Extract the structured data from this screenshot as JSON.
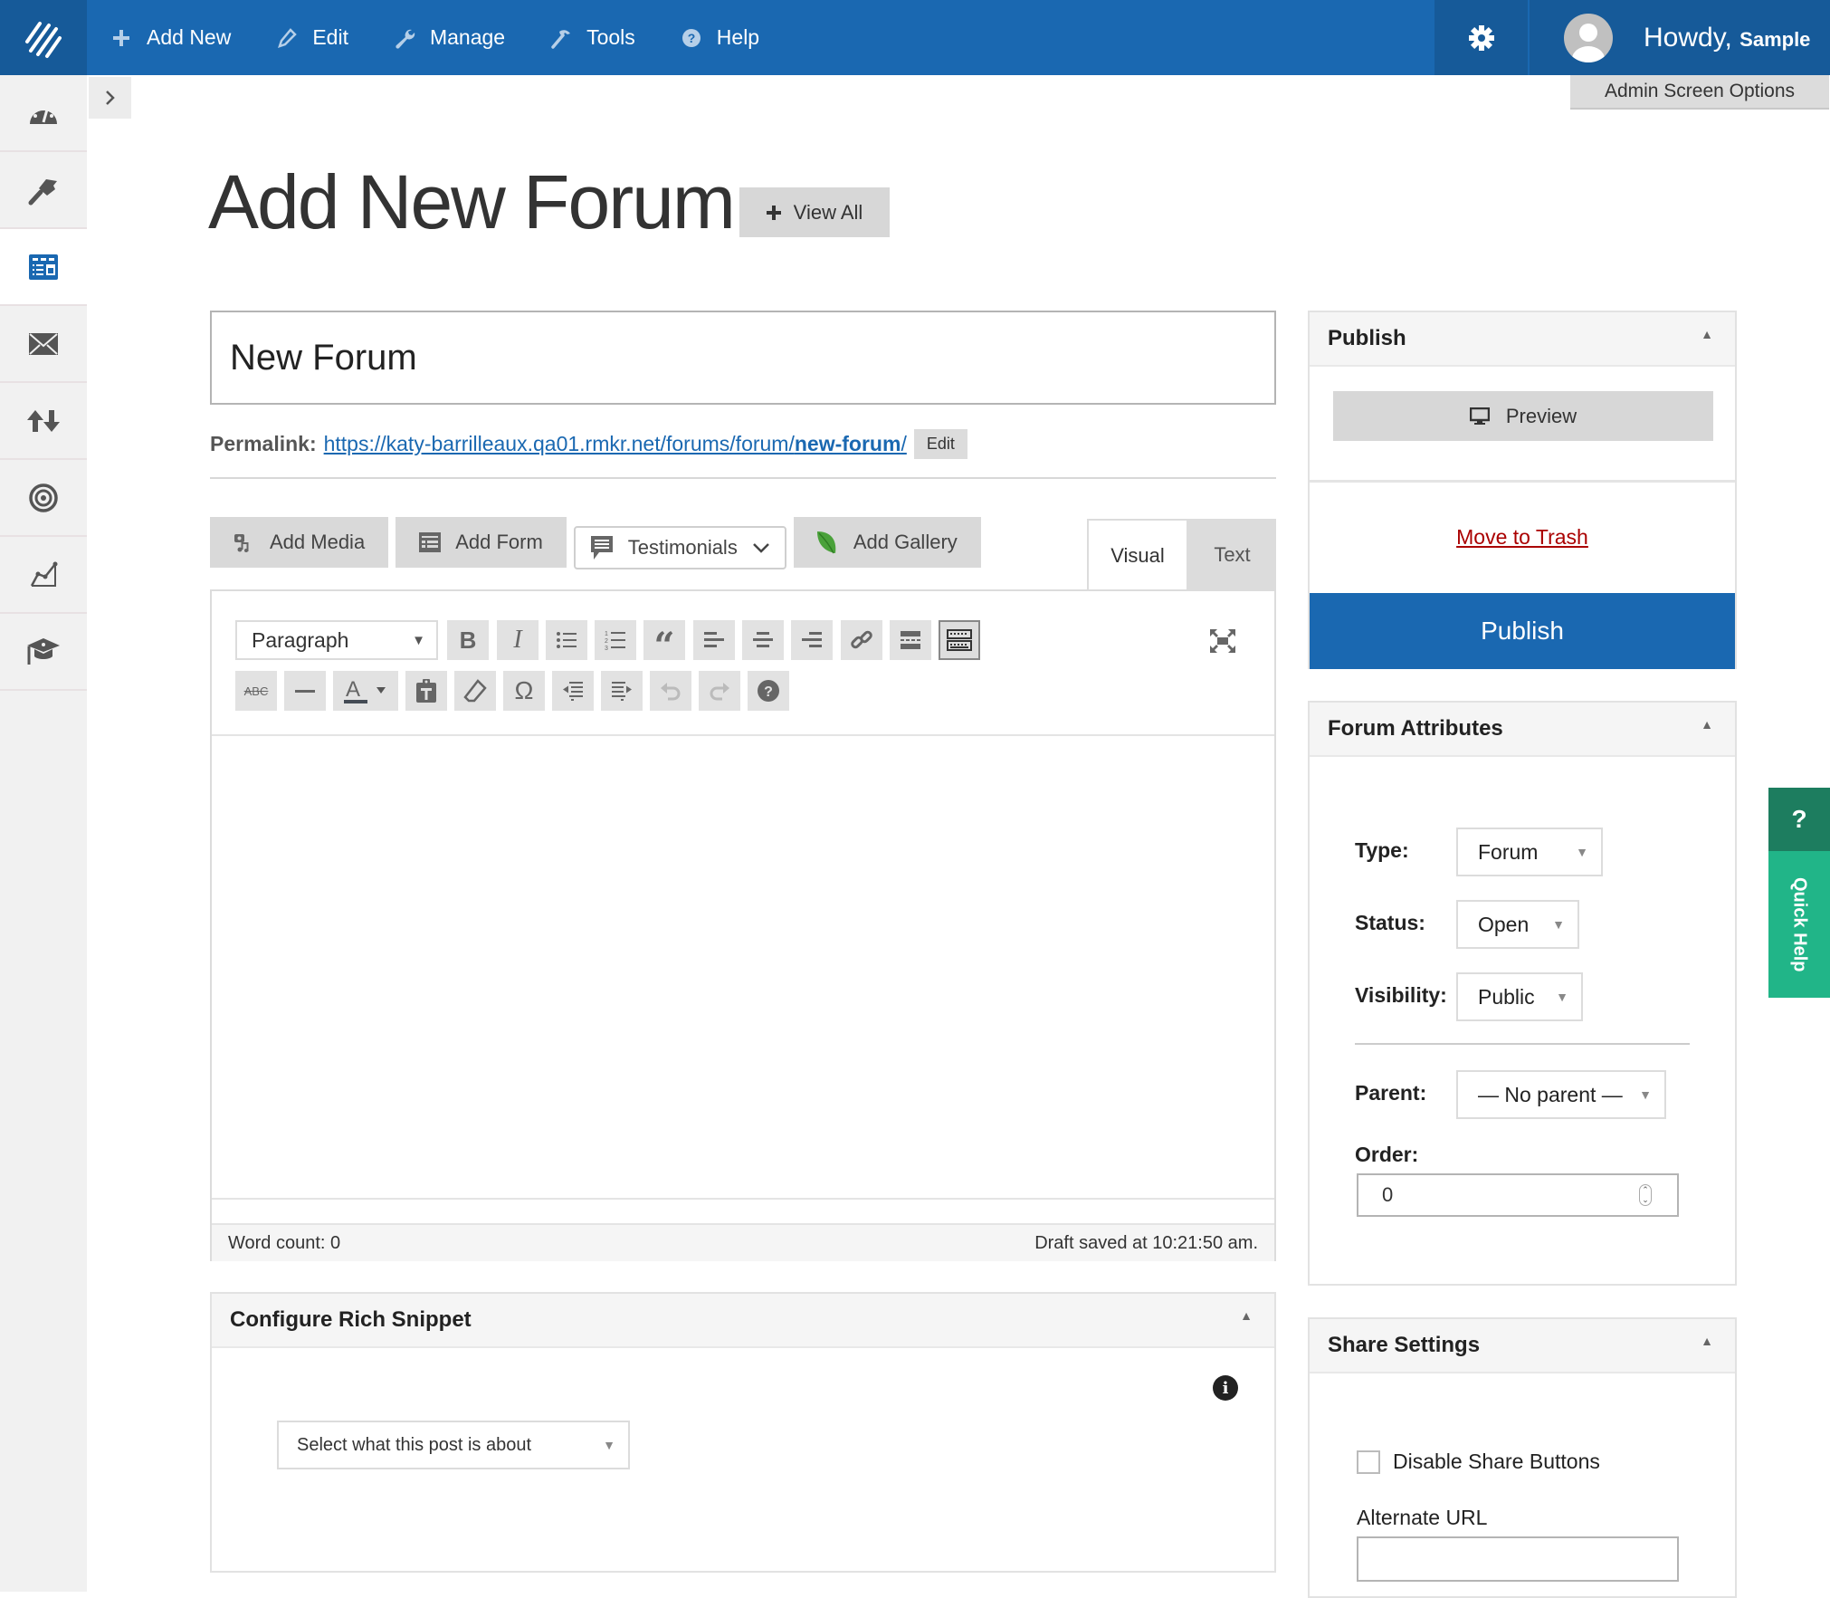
{
  "topbar": {
    "nav": [
      {
        "label": "Add New",
        "icon": "plus-icon"
      },
      {
        "label": "Edit",
        "icon": "pencil-icon"
      },
      {
        "label": "Manage",
        "icon": "wrench-icon"
      },
      {
        "label": "Tools",
        "icon": "hammer-icon"
      },
      {
        "label": "Help",
        "icon": "question-circle-icon"
      }
    ],
    "howdy": "Howdy,",
    "user_name": "Sample",
    "screen_options": "Admin Screen Options"
  },
  "sidebar": {
    "items": [
      {
        "icon": "dashboard-icon",
        "active": false
      },
      {
        "icon": "paintbrush-icon",
        "active": false
      },
      {
        "icon": "forms-icon",
        "active": true
      },
      {
        "icon": "envelope-icon",
        "active": false
      },
      {
        "icon": "transfer-arrows-icon",
        "active": false
      },
      {
        "icon": "target-icon",
        "active": false
      },
      {
        "icon": "analytics-chart-icon",
        "active": false
      },
      {
        "icon": "graduation-cap-icon",
        "active": false
      }
    ],
    "accent_color": "#1a68b1"
  },
  "page": {
    "title": "Add New Forum",
    "view_all": "View All"
  },
  "editor": {
    "title_value": "New Forum",
    "permalink_label": "Permalink:",
    "permalink_base": "https://katy-barrilleaux.qa01.rmkr.net/forums/forum/",
    "permalink_slug": "new-forum",
    "permalink_trailing": "/",
    "permalink_edit": "Edit",
    "media_buttons": {
      "add_media": "Add Media",
      "add_form": "Add Form",
      "testimonials": "Testimonials",
      "add_gallery": "Add Gallery"
    },
    "tabs": {
      "visual": "Visual",
      "text": "Text"
    },
    "format_select": "Paragraph",
    "word_count": "Word count: 0",
    "draft_saved": "Draft saved at 10:21:50 am."
  },
  "snippet": {
    "title": "Configure Rich Snippet",
    "select_placeholder": "Select what this post is about"
  },
  "publish": {
    "title": "Publish",
    "preview": "Preview",
    "trash": "Move to Trash",
    "publish": "Publish",
    "publish_color": "#1a68b1",
    "trash_color": "#aa0000"
  },
  "attributes": {
    "title": "Forum Attributes",
    "type_label": "Type:",
    "type_value": "Forum",
    "status_label": "Status:",
    "status_value": "Open",
    "visibility_label": "Visibility:",
    "visibility_value": "Public",
    "parent_label": "Parent:",
    "parent_value": "— No parent —",
    "order_label": "Order:",
    "order_value": "0"
  },
  "share": {
    "title": "Share Settings",
    "disable_label": "Disable Share Buttons",
    "disable_checked": false,
    "alt_url_label": "Alternate URL",
    "alt_url_value": ""
  },
  "quick_help": {
    "icon": "?",
    "label": "Quick Help",
    "color": "#21b588"
  }
}
